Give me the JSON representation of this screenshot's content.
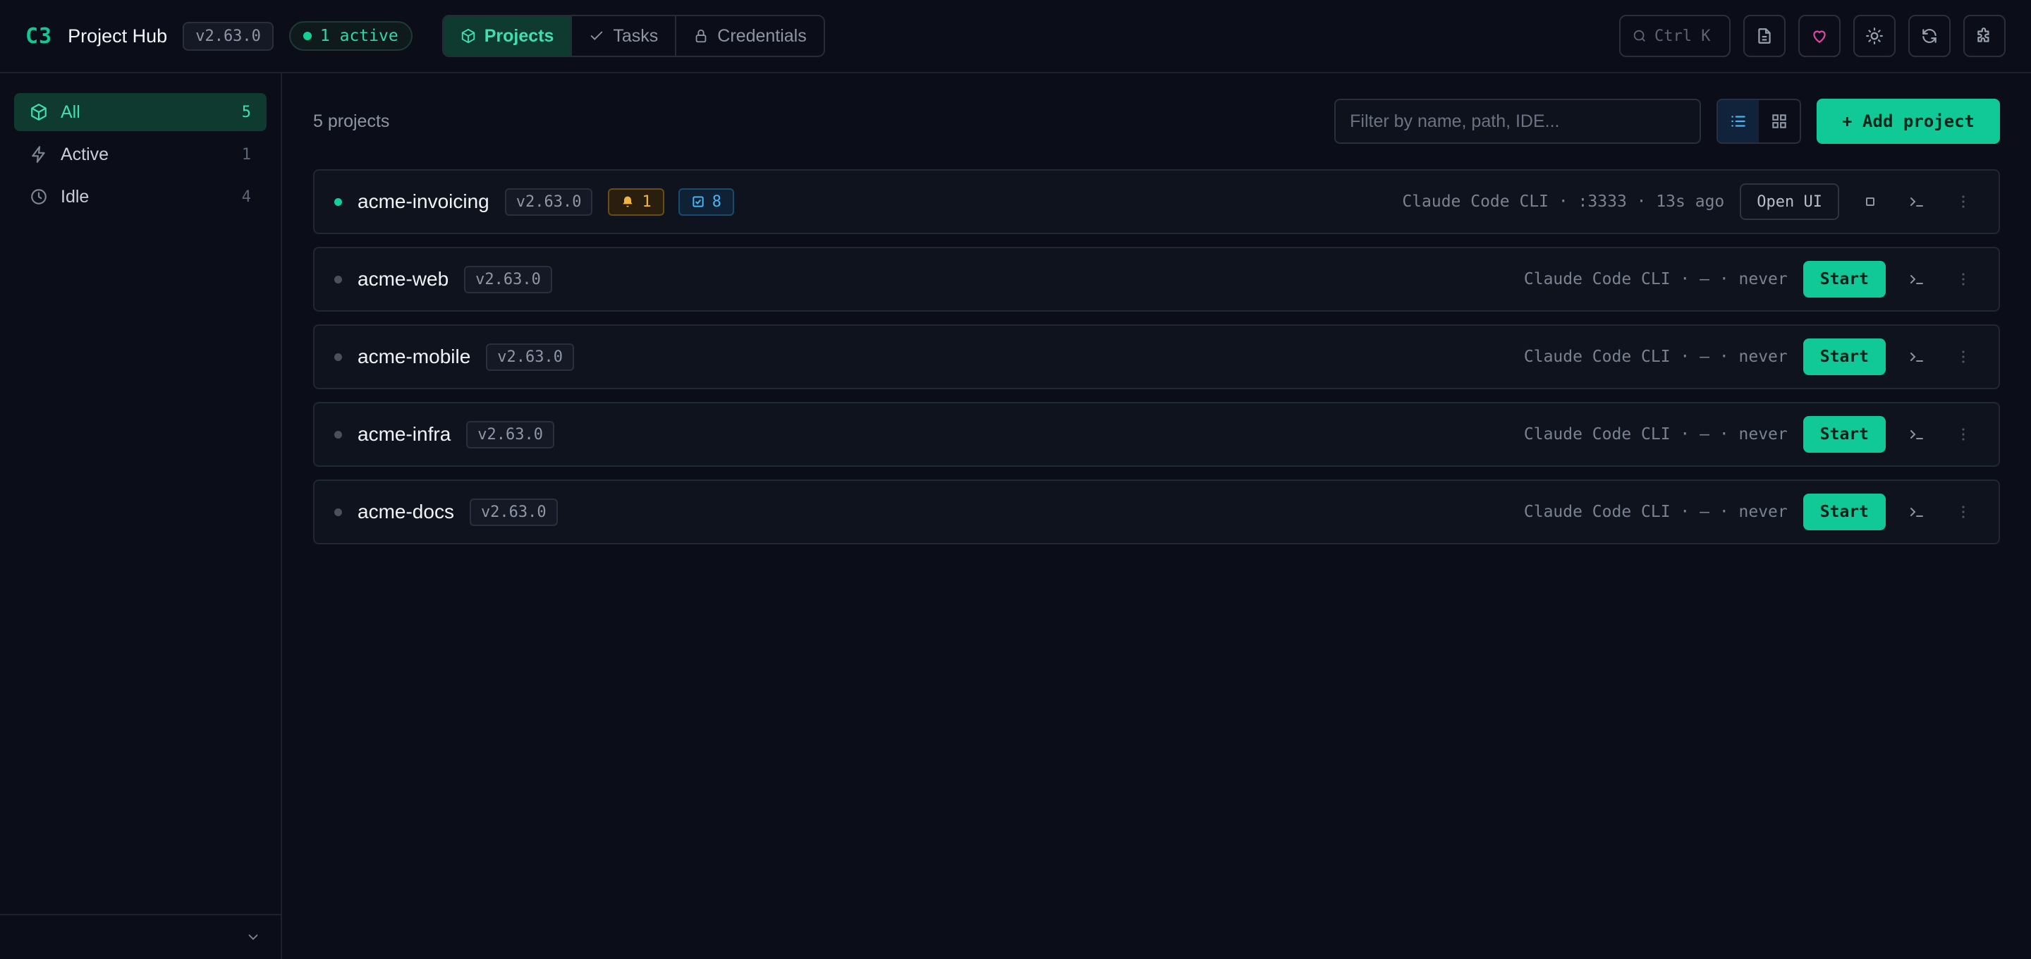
{
  "header": {
    "logo": "C3",
    "title": "Project Hub",
    "version": "v2.63.0",
    "active_badge": "1 active",
    "nav": [
      {
        "label": "Projects",
        "icon": "cube-icon",
        "active": true
      },
      {
        "label": "Tasks",
        "icon": "check-icon",
        "active": false
      },
      {
        "label": "Credentials",
        "icon": "lock-icon",
        "active": false
      }
    ],
    "search_shortcut": "Ctrl K"
  },
  "sidebar": {
    "items": [
      {
        "label": "All",
        "count": "5",
        "icon": "cube-icon",
        "active": true
      },
      {
        "label": "Active",
        "count": "1",
        "icon": "bolt-icon",
        "active": false
      },
      {
        "label": "Idle",
        "count": "4",
        "icon": "clock-icon",
        "active": false
      }
    ]
  },
  "main": {
    "project_count": "5 projects",
    "filter_placeholder": "Filter by name, path, IDE...",
    "add_button": "+ Add project"
  },
  "projects": [
    {
      "name": "acme-invoicing",
      "version": "v2.63.0",
      "notifications": "1",
      "tasks": "8",
      "meta": "Claude Code CLI · :3333 · 13s ago",
      "action": "Open UI",
      "running": true
    },
    {
      "name": "acme-web",
      "version": "v2.63.0",
      "meta": "Claude Code CLI · — · never",
      "action": "Start",
      "running": false
    },
    {
      "name": "acme-mobile",
      "version": "v2.63.0",
      "meta": "Claude Code CLI · — · never",
      "action": "Start",
      "running": false
    },
    {
      "name": "acme-infra",
      "version": "v2.63.0",
      "meta": "Claude Code CLI · — · never",
      "action": "Start",
      "running": false
    },
    {
      "name": "acme-docs",
      "version": "v2.63.0",
      "meta": "Claude Code CLI · — · never",
      "action": "Start",
      "running": false
    }
  ],
  "colors": {
    "accent": "#10c996",
    "background": "#0b0e18",
    "warning": "#f2b544",
    "info": "#4ab4f0"
  }
}
